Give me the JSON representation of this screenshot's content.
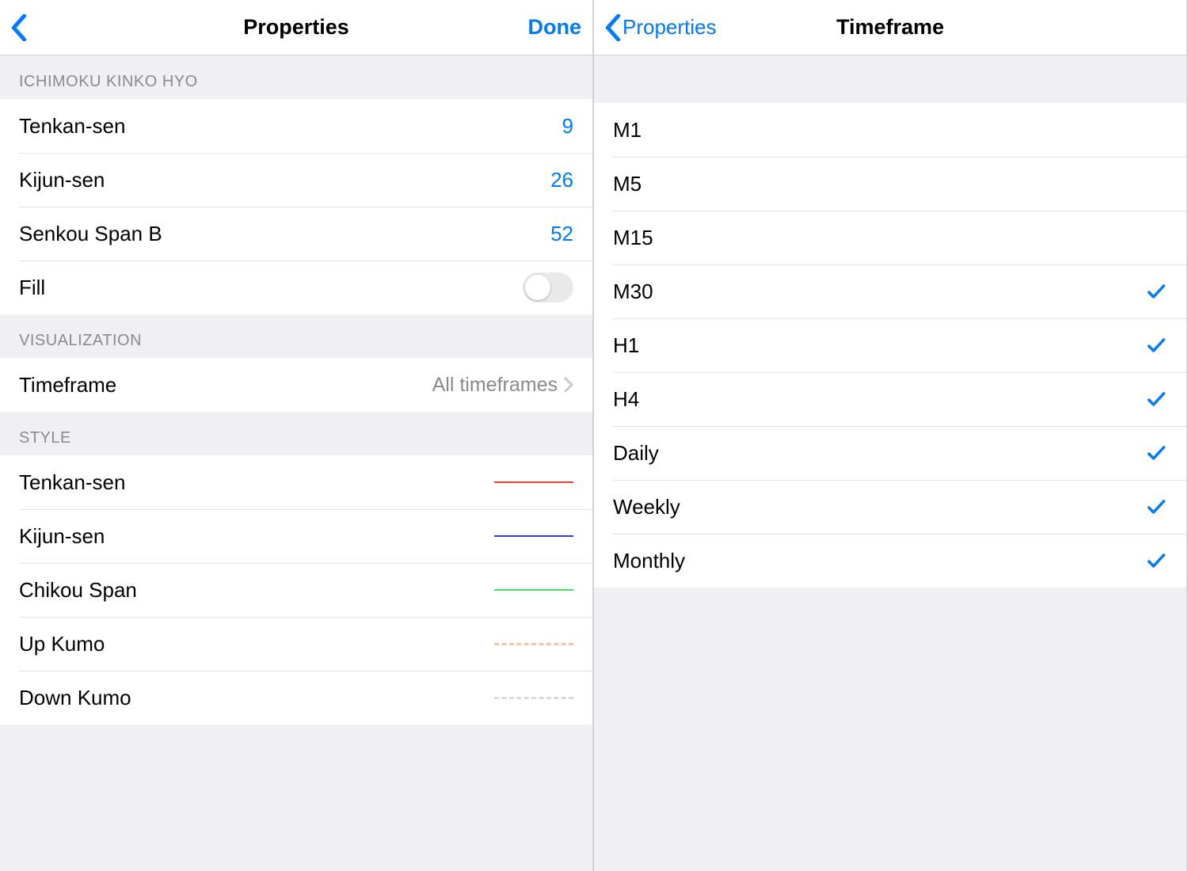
{
  "left": {
    "nav": {
      "title": "Properties",
      "done": "Done"
    },
    "sections": {
      "ichimoku": {
        "header": "ICHIMOKU KINKO HYO",
        "tenkan_label": "Tenkan-sen",
        "tenkan_value": "9",
        "kijun_label": "Kijun-sen",
        "kijun_value": "26",
        "senkou_label": "Senkou Span B",
        "senkou_value": "52",
        "fill_label": "Fill",
        "fill_on": false
      },
      "visualization": {
        "header": "VISUALIZATION",
        "timeframe_label": "Timeframe",
        "timeframe_value": "All timeframes"
      },
      "style": {
        "header": "STYLE",
        "items": [
          {
            "label": "Tenkan-sen",
            "color": "#ff3b30",
            "dashed": false
          },
          {
            "label": "Kijun-sen",
            "color": "#2b3fd8",
            "dashed": false
          },
          {
            "label": "Chikou Span",
            "color": "#4cd964",
            "dashed": false
          },
          {
            "label": "Up Kumo",
            "color": "#f5c6a5",
            "dashed": true
          },
          {
            "label": "Down Kumo",
            "color": "#d9d9de",
            "dashed": true
          }
        ]
      }
    }
  },
  "right": {
    "nav": {
      "back": "Properties",
      "title": "Timeframe"
    },
    "items": [
      {
        "label": "M1",
        "checked": false
      },
      {
        "label": "M5",
        "checked": false
      },
      {
        "label": "M15",
        "checked": false
      },
      {
        "label": "M30",
        "checked": true
      },
      {
        "label": "H1",
        "checked": true
      },
      {
        "label": "H4",
        "checked": true
      },
      {
        "label": "Daily",
        "checked": true
      },
      {
        "label": "Weekly",
        "checked": true
      },
      {
        "label": "Monthly",
        "checked": true
      }
    ]
  }
}
